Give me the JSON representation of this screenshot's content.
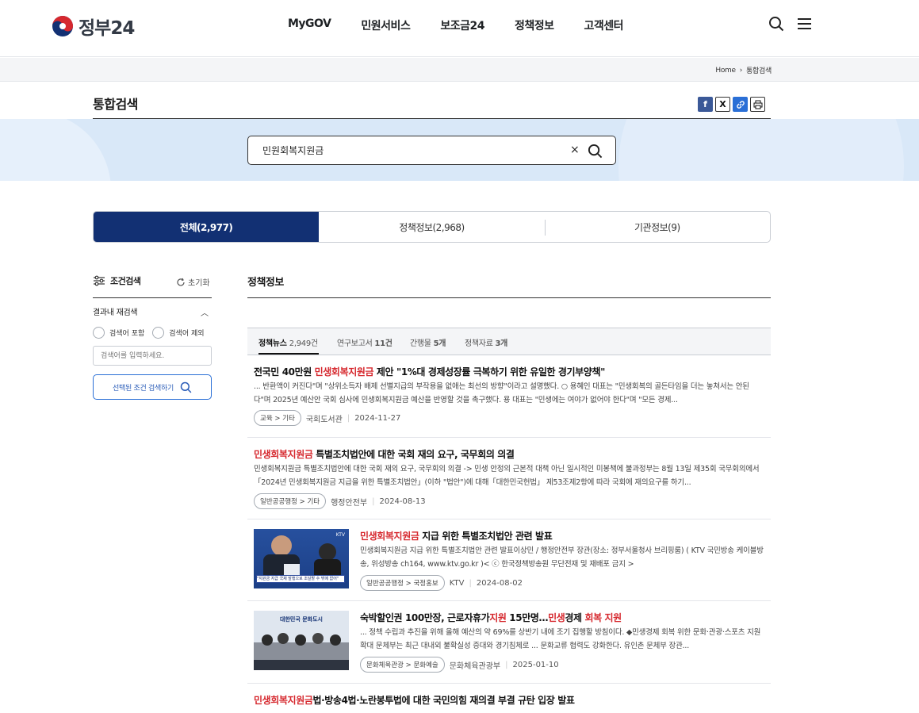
{
  "header": {
    "logo_text": "정부24",
    "nav": [
      "MyGOV",
      "민원서비스",
      "보조금24",
      "정책정보",
      "고객센터"
    ]
  },
  "breadcrumb": {
    "home": "Home",
    "current": "통합검색"
  },
  "page": {
    "title": "통합검색"
  },
  "share": {
    "facebook": "f",
    "x": "X",
    "link": "🔗",
    "print": "⎙"
  },
  "search": {
    "value": "민원회복지원금",
    "clear": "×"
  },
  "tabs": [
    "전체(2,977)",
    "정책정보(2,968)",
    "기관정보(9)"
  ],
  "filter": {
    "title": "조건검색",
    "reset": "초기화",
    "re_search": "결과내 재검색",
    "include": "검색어 포함",
    "exclude": "검색어 제외",
    "input_placeholder": "검색어를 입력하세요.",
    "apply": "선택된 조건 검색하기"
  },
  "section_title": "정책정보",
  "subtabs": [
    {
      "label": "정책뉴스",
      "count": "2,949건"
    },
    {
      "label": "연구보고서",
      "count": "11건"
    },
    {
      "label": "간행물",
      "count": "5개"
    },
    {
      "label": "정책자료",
      "count": "3개"
    }
  ],
  "results": [
    {
      "title_pre": "전국민 40만원 ",
      "title_hl": "민생회복지원금",
      "title_post": " 제안 \"1%대 경제성장률 극복하기 위한 유일한 경기부양책\"",
      "desc": "... 반환액이 커진다\"며 \"상위소득자 배제 선별지급의 부작용을 없애는 최선의 방향\"이라고 설명했다. ○ 용혜인 대표는 \"민생회복의 골든타임을 더는 놓쳐서는 안된다\"며 2025년 예산안 국회 심사에 민생회복지원금 예산을 반영할 것을 촉구했다. 용 대표는 \"민생에는 여야가 없어야 한다\"며 \"모든 경제...",
      "tag": "교육 > 기타",
      "source": "국회도서관",
      "date": "2024-11-27"
    },
    {
      "title_pre": "",
      "title_hl": "민생회복지원금",
      "title_post": " 특별조치법안에 대한 국회 재의 요구, 국무회의 의결",
      "desc": "민생회복지원금 특별조치법안에 대한 국회 재의 요구, 국무회의 의결 -> 민생 안정의 근본적 대책 아닌 일시적인 미봉책에 불과정부는 8월 13일 제35회 국무회의에서 「2024년 민생회복지원금 지급을 위한 특별조치법안」(이하 \"법안\")에 대해「대한민국헌법」 제53조제2항에 따라 국회에 재의요구를 하기...",
      "tag": "일반공공행정 > 기타",
      "source": "행정안전부",
      "date": "2024-08-13"
    },
    {
      "title_pre": "",
      "title_hl": "민생회복지원금",
      "title_post": " 지급 위한 특별조치법안 관련 발표",
      "desc": "민생회복지원금 지급 위한 특별조치법안 관련 발표이상민 / 행정안전부 장관(장소: 정부서울청사 브리핑룸) ( KTV 국민방송 케이블방송, 위성방송 ch164, www.ktv.go.kr )< ⓒ 한국정책방송원 무단전재 및 재배포 금지 >",
      "tag": "일반공공행정 > 국정홍보",
      "source": "KTV",
      "date": "2024-08-02",
      "thumb_caption": "\"지원금 지급 국채 발행으로 조달할 수 밖에 없어\"",
      "thumb_badge": "KTV"
    },
    {
      "title_a": "숙박할인권 100만장, 근로자휴가",
      "title_b": "지원",
      "title_c": " 15만명…",
      "title_d": "민생",
      "title_e": "경제 ",
      "title_f": "회복 지원",
      "desc": "... 정책 수립과 추진을 위해 올해 예산의 약 69%를 상반기 내에 조기 집행할 방침이다. ◆민생경제 회복 위한 문화·관광·스포츠 지원 확대 문체부는 최근 대내외 불확실성 증대와 경기침체로 ... 문화교류 협력도 강화한다. 유인촌 문체부 장관...",
      "tag": "문화체육관광 > 문화예술",
      "source": "문화체육관광부",
      "date": "2025-01-10",
      "thumb_caption": "대한민국 문화도시"
    },
    {
      "title_hl": "민생회복지원금",
      "title_post": "법·방송4법·노란봉투법에 대한 국민의힘 재의결 부결 규탄 입장 발표"
    }
  ],
  "colors": {
    "primary": "#123073",
    "highlight": "#d6282e",
    "band": "#d9e8f8"
  }
}
